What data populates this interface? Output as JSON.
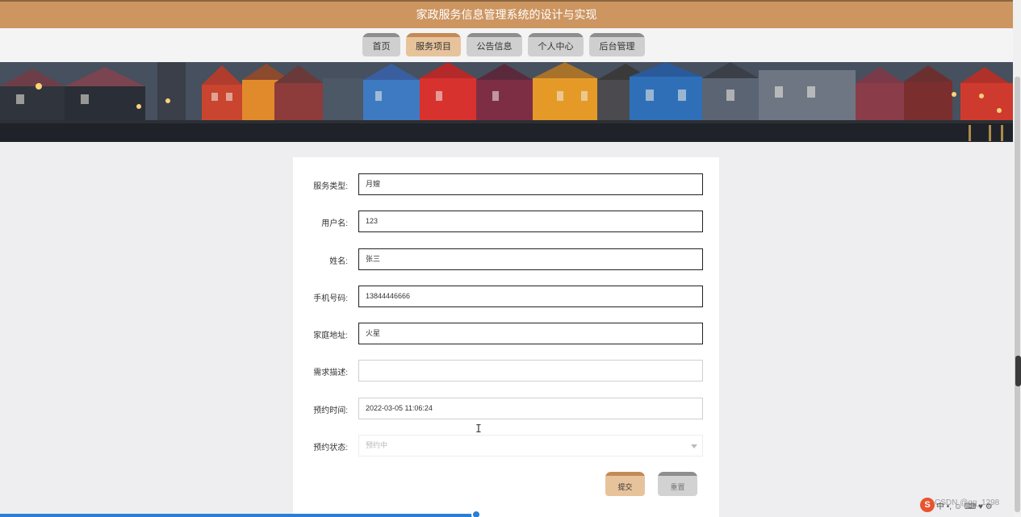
{
  "header": {
    "title": "家政服务信息管理系统的设计与实现"
  },
  "nav": {
    "items": [
      {
        "label": "首页",
        "active": false
      },
      {
        "label": "服务项目",
        "active": true
      },
      {
        "label": "公告信息",
        "active": false
      },
      {
        "label": "个人中心",
        "active": false
      },
      {
        "label": "后台管理",
        "active": false
      }
    ]
  },
  "form": {
    "fields": [
      {
        "label": "服务类型:",
        "value": "月嫂"
      },
      {
        "label": "用户名:",
        "value": "123"
      },
      {
        "label": "姓名:",
        "value": "张三"
      },
      {
        "label": "手机号码:",
        "value": "13844446666"
      },
      {
        "label": "家庭地址:",
        "value": "火星"
      },
      {
        "label": "需求描述:",
        "value": ""
      },
      {
        "label": "预约时间:",
        "value": "2022-03-05 11:06:24"
      },
      {
        "label": "预约状态:",
        "value": "预约中"
      }
    ],
    "submit_label": "提交",
    "reset_label": "重置"
  },
  "taskbar": {
    "ime_text": "中 •, ☺ ⌨ ♥ ⚙",
    "watermark": "CSDN @qq_1298"
  },
  "colors": {
    "brand": "#cd9560",
    "active_tab": "#e7c39b",
    "progress": "#2a7fd4"
  }
}
